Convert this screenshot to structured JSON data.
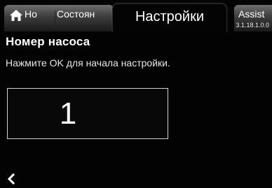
{
  "tabs": {
    "home_label": "Но",
    "status_label": "Состоян",
    "active_label": "Настройки",
    "assist_label": "Assist",
    "home_icon": "home-icon"
  },
  "version": "3.1.18.1.0.0",
  "page": {
    "title": "Номер насоса",
    "instruction": "Нажмите OK для начала настройки."
  },
  "value": {
    "current": "1"
  },
  "navigation": {
    "back_icon": "chevron-left-icon"
  },
  "colors": {
    "background": "#030303",
    "text": "#ffffff",
    "box_border": "#d0d0d0",
    "tab_inactive_top": "#6e6e6e",
    "tab_inactive_bottom": "#1a1a1a"
  }
}
